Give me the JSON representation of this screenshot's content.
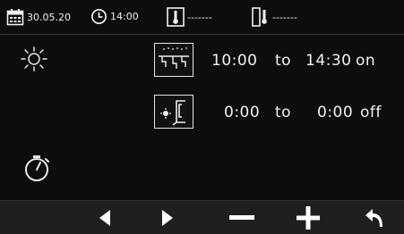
{
  "statusbar": {
    "date": "30.05.20",
    "time": "14:00",
    "temp1": "-------",
    "temp2": "-------"
  },
  "icons": {
    "calendar": "calendar-icon",
    "clock": "clock-icon",
    "thermometer_indoor": "indoor-thermometer-icon",
    "thermometer_outdoor": "outdoor-thermometer-icon",
    "sun": "sun-icon",
    "timer": "timer-icon",
    "shower": "shower-icon",
    "heat": "heating-appliance-icon"
  },
  "schedule": [
    {
      "from": "10:00",
      "connector": "to",
      "to": "14:30",
      "state": "on"
    },
    {
      "from": "0:00",
      "connector": "to",
      "to": "0:00",
      "state": "off"
    }
  ],
  "toolbar": {
    "buttons": [
      "prev",
      "next",
      "minus",
      "plus",
      "back"
    ]
  },
  "colors": {
    "background": "#0d0d0d",
    "toolbar": "#1f1f1f",
    "foreground": "#f2f2f2"
  }
}
